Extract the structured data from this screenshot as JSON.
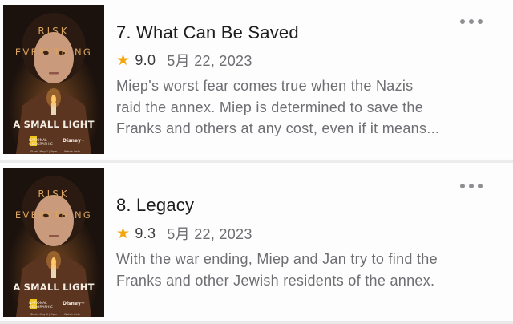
{
  "episodes": [
    {
      "title": "7. What Can Be Saved",
      "rating": "9.0",
      "date": "5月 22, 2023",
      "description_lines": [
        "Miep's worst fear comes true when the Nazis",
        "raid the annex. Miep is determined to save the",
        "Franks and others at any cost, even if it means..."
      ],
      "poster": {
        "tagline_top": "RISK",
        "tagline_bottom": "EVERYTHING",
        "show_title": "A SMALL LIGHT",
        "brand_left": "NATIONAL GEOGRAPHIC",
        "brand_right": "Disney+",
        "sub_left": "Starts May 1 | 9pm",
        "sub_right": "Watch Only"
      },
      "more_icon": "ellipsis-icon"
    },
    {
      "title": "8. Legacy",
      "rating": "9.3",
      "date": "5月 22, 2023",
      "description_lines": [
        "With the war ending, Miep and Jan try to find the",
        "Franks and other Jewish residents of the annex."
      ],
      "poster": {
        "tagline_top": "RISK",
        "tagline_bottom": "EVERYTHING",
        "show_title": "A SMALL LIGHT",
        "brand_left": "NATIONAL GEOGRAPHIC",
        "brand_right": "Disney+",
        "sub_left": "Starts May 1 | 9pm",
        "sub_right": "Watch Only"
      },
      "more_icon": "ellipsis-icon"
    }
  ],
  "icons": {
    "rating": "star-icon",
    "more": "ellipsis-icon"
  },
  "colors": {
    "star": "#f2a70f",
    "title": "#1d1d1f",
    "text": "#6e6e73",
    "poster_accent": "#d9a25d"
  }
}
